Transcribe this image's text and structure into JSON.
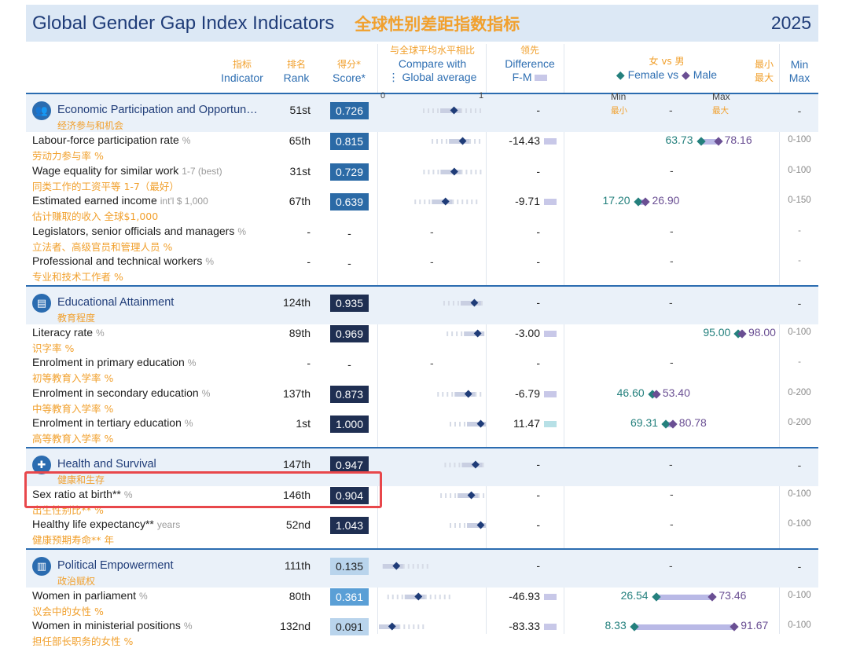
{
  "header": {
    "title": "Global Gender Gap Index Indicators",
    "title_cn": "全球性别差距指数指标",
    "year": "2025"
  },
  "columns": {
    "indicator_cn": "指标",
    "indicator": "Indicator",
    "rank_cn": "排名",
    "rank": "Rank",
    "score_cn": "得分*",
    "score": "Score*",
    "compare_cn": "与全球平均水平相比",
    "compare_1": "Compare with",
    "compare_2": "⋮ Global average",
    "diff_cn": "领先",
    "diff_1": "Difference",
    "diff_2": "F-M",
    "fvm_cn": "女 vs 男",
    "fvm_female": "Female vs",
    "fvm_male": "Male",
    "minmax_cn_1": "最小",
    "minmax_cn_2": "最大",
    "minmax_1": "Min",
    "minmax_2": "Max",
    "scale_0": "0",
    "scale_1": "1",
    "min_label": "Min",
    "min_cn": "最小",
    "max_label": "Max",
    "max_cn": "最大"
  },
  "colors": {
    "section_bg": "#eaf1f9",
    "score_dark": "#1f2f52",
    "score_mid": "#2b6aa6",
    "score_light": "#5a9fd6",
    "score_pale": "#b9d4ec",
    "female": "#24807d",
    "male": "#6a4f93",
    "highlight": "#e8474b",
    "accent_cn": "#f1a02d"
  },
  "dash": "-",
  "sections": [
    {
      "title": "Economic Participation and Opportun…",
      "title_cn": "经济参与和机会",
      "icon": "people-icon",
      "rank": "51st",
      "score": "0.726",
      "score_fill": "mid",
      "diff": "-",
      "fm": "-",
      "minmax": "-",
      "marker": 0.726,
      "rows": [
        {
          "label": "Labour-force participation rate",
          "unit": "%",
          "label_cn": "劳动力参与率 %",
          "rank": "65th",
          "score": "0.815",
          "score_fill": "mid",
          "marker": 0.815,
          "diff": "-14.43",
          "female": "63.73",
          "male": "78.16",
          "fm_range": [
            0,
            100
          ],
          "minmax": "0-100"
        },
        {
          "label": "Wage equality for similar work",
          "unit": "1-7 (best)",
          "label_cn": "同类工作的工资平等 1-7（最好）",
          "rank": "31st",
          "score": "0.729",
          "score_fill": "mid",
          "marker": 0.729,
          "diff": "-",
          "female": "",
          "male": "",
          "fm_range": [
            0,
            100
          ],
          "minmax": "0-100"
        },
        {
          "label": "Estimated earned income",
          "unit": "int'l $ 1,000",
          "label_cn": "估计赚取的收入 全球$1,000",
          "rank": "67th",
          "score": "0.639",
          "score_fill": "mid",
          "marker": 0.639,
          "diff": "-9.71",
          "female": "17.20",
          "male": "26.90",
          "fm_range": [
            0,
            150
          ],
          "minmax": "0-150"
        },
        {
          "label": "Legislators, senior officials and managers",
          "unit": "%",
          "label_cn": "立法者、高级官员和管理人员 %",
          "rank": "-",
          "score": "-",
          "score_fill": "none",
          "marker": null,
          "diff": "-",
          "female": "",
          "male": "",
          "fm_range": [
            0,
            100
          ],
          "minmax": "-"
        },
        {
          "label": "Professional and technical workers",
          "unit": "%",
          "label_cn": "专业和技术工作者 %",
          "rank": "-",
          "score": "-",
          "score_fill": "none",
          "marker": null,
          "diff": "-",
          "female": "",
          "male": "",
          "fm_range": [
            0,
            100
          ],
          "minmax": "-"
        }
      ]
    },
    {
      "title": "Educational Attainment",
      "title_cn": "教育程度",
      "icon": "book-icon",
      "rank": "124th",
      "score": "0.935",
      "score_fill": "dark",
      "diff": "-",
      "fm": "-",
      "minmax": "-",
      "marker": 0.935,
      "rows": [
        {
          "label": "Literacy rate",
          "unit": "%",
          "label_cn": "识字率 %",
          "rank": "89th",
          "score": "0.969",
          "score_fill": "dark",
          "marker": 0.969,
          "diff": "-3.00",
          "female": "95.00",
          "male": "98.00",
          "fm_range": [
            0,
            100
          ],
          "minmax": "0-100"
        },
        {
          "label": "Enrolment in primary education",
          "unit": "%",
          "label_cn": "初等教育入学率 %",
          "rank": "-",
          "score": "-",
          "score_fill": "none",
          "marker": null,
          "diff": "-",
          "female": "",
          "male": "",
          "fm_range": [
            0,
            100
          ],
          "minmax": "-"
        },
        {
          "label": "Enrolment in secondary education",
          "unit": "%",
          "label_cn": "中等教育入学率 %",
          "rank": "137th",
          "score": "0.873",
          "score_fill": "dark",
          "marker": 0.873,
          "diff": "-6.79",
          "female": "46.60",
          "male": "53.40",
          "fm_range": [
            0,
            200
          ],
          "minmax": "0-200"
        },
        {
          "label": "Enrolment in tertiary education",
          "unit": "%",
          "label_cn": "高等教育入学率 %",
          "rank": "1st",
          "score": "1.000",
          "score_fill": "dark",
          "marker": 1.0,
          "diff": "11.47",
          "female": "69.31",
          "male": "80.78",
          "fm_range": [
            0,
            200
          ],
          "minmax": "0-200"
        }
      ]
    },
    {
      "title": "Health and Survival",
      "title_cn": "健康和生存",
      "icon": "cross-icon",
      "rank": "147th",
      "score": "0.947",
      "score_fill": "dark",
      "diff": "-",
      "fm": "-",
      "minmax": "-",
      "marker": 0.947,
      "rows": [
        {
          "label": "Sex ratio at birth**",
          "unit": "%",
          "label_cn": "出生性别比** %",
          "rank": "146th",
          "score": "0.904",
          "score_fill": "dark",
          "marker": 0.904,
          "diff": "-",
          "female": "",
          "male": "",
          "fm_range": [
            0,
            100
          ],
          "minmax": "0-100"
        },
        {
          "label": "Healthy life expectancy**",
          "unit": "years",
          "label_cn": "健康预期寿命** 年",
          "rank": "52nd",
          "score": "1.043",
          "score_fill": "dark",
          "marker": 1.0,
          "diff": "-",
          "female": "",
          "male": "",
          "fm_range": [
            0,
            100
          ],
          "minmax": "0-100"
        }
      ]
    },
    {
      "title": "Political Empowerment",
      "title_cn": "政治赋权",
      "icon": "building-icon",
      "rank": "111th",
      "score": "0.135",
      "score_fill": "pale",
      "diff": "-",
      "fm": "-",
      "minmax": "-",
      "marker": 0.135,
      "rows": [
        {
          "label": "Women in parliament",
          "unit": "%",
          "label_cn": "议会中的女性 %",
          "rank": "80th",
          "score": "0.361",
          "score_fill": "light",
          "marker": 0.361,
          "diff": "-46.93",
          "female": "26.54",
          "male": "73.46",
          "fm_range": [
            0,
            100
          ],
          "minmax": "0-100"
        },
        {
          "label": "Women in ministerial positions",
          "unit": "%",
          "label_cn": "担任部长职务的女性 %",
          "rank": "132nd",
          "score": "0.091",
          "score_fill": "pale",
          "marker": 0.091,
          "diff": "-83.33",
          "female": "8.33",
          "male": "91.67",
          "fm_range": [
            0,
            100
          ],
          "minmax": "0-100"
        }
      ]
    }
  ]
}
